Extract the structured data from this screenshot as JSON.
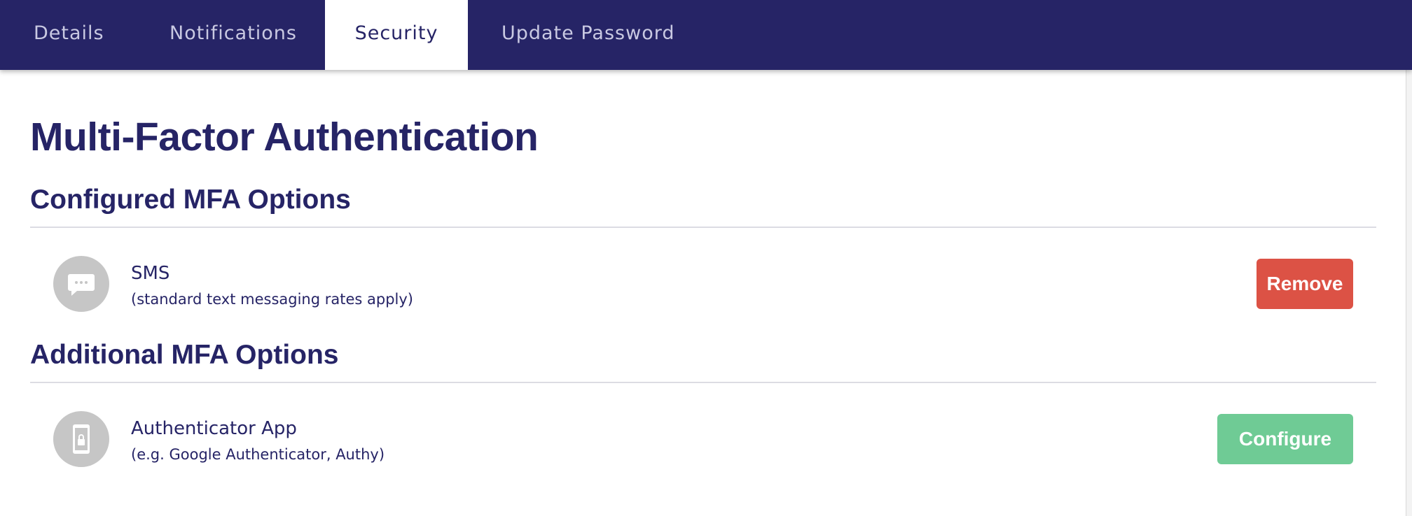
{
  "tabs": [
    {
      "label": "Details",
      "active": false
    },
    {
      "label": "Notifications",
      "active": false
    },
    {
      "label": "Security",
      "active": true
    },
    {
      "label": "Update Password",
      "active": false
    }
  ],
  "page_title": "Multi-Factor Authentication",
  "configured": {
    "heading": "Configured MFA Options",
    "items": [
      {
        "icon": "chat-bubble-icon",
        "name": "SMS",
        "note": "(standard text messaging rates apply)",
        "action_label": "Remove"
      }
    ]
  },
  "additional": {
    "heading": "Additional MFA Options",
    "items": [
      {
        "icon": "phone-lock-icon",
        "name": "Authenticator App",
        "note": "(e.g. Google Authenticator, Authy)",
        "action_label": "Configure"
      }
    ]
  },
  "colors": {
    "nav_background": "#262466",
    "text_primary": "#262466",
    "remove_button": "#dc5245",
    "configure_button": "#6fcb95",
    "icon_circle": "#c6c6c6"
  }
}
